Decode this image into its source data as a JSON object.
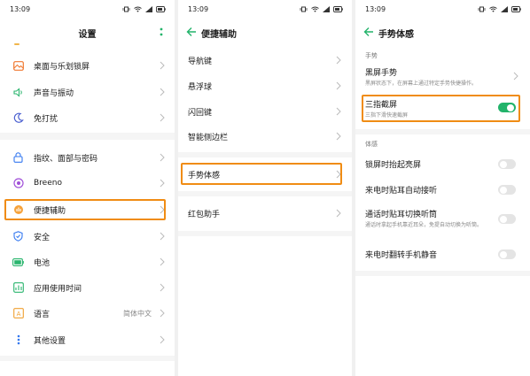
{
  "status": {
    "time": "13:09"
  },
  "colors": {
    "accent": "#22b36a",
    "highlight": "#f08c14",
    "back_arrow": "#22b36a"
  },
  "panel1": {
    "title": "设置",
    "items": [
      {
        "label": "桌面与乐划锁屏",
        "icon": "wallpaper-icon"
      },
      {
        "label": "声音与振动",
        "icon": "sound-icon"
      },
      {
        "label": "免打扰",
        "icon": "moon-icon"
      },
      {
        "label": "指纹、面部与密码",
        "icon": "lock-icon"
      },
      {
        "label": "Breeno",
        "icon": "breeno-icon"
      },
      {
        "label": "便捷辅助",
        "icon": "hand-icon"
      },
      {
        "label": "安全",
        "icon": "shield-icon"
      },
      {
        "label": "电池",
        "icon": "battery-icon"
      },
      {
        "label": "应用使用时间",
        "icon": "app-time-icon"
      },
      {
        "label": "语言",
        "icon": "language-icon",
        "value": "简体中文"
      },
      {
        "label": "其他设置",
        "icon": "other-settings-icon"
      }
    ]
  },
  "panel2": {
    "title": "便捷辅助",
    "items": [
      {
        "label": "导航键"
      },
      {
        "label": "悬浮球"
      },
      {
        "label": "闪回键"
      },
      {
        "label": "智能侧边栏"
      },
      {
        "label": "手势体感"
      },
      {
        "label": "红包助手"
      }
    ]
  },
  "panel3": {
    "title": "手势体感",
    "section1": "手势",
    "section2": "体感",
    "black_screen": {
      "label": "黑屏手势",
      "sub": "黑屏状态下，在屏幕上通过特定手势快捷操作。"
    },
    "three_finger": {
      "label": "三指截屏",
      "sub": "三指下滑快速截屏",
      "on": true
    },
    "sensor_items": [
      {
        "label": "锁屏时抬起亮屏",
        "on": false
      },
      {
        "label": "来电时贴耳自动接听",
        "on": false
      },
      {
        "label": "通话时贴耳切换听筒",
        "sub": "通话时拿起手机靠近耳朵，免提自动切换为听筒。",
        "on": false
      },
      {
        "label": "来电时翻转手机静音",
        "on": false
      }
    ]
  }
}
